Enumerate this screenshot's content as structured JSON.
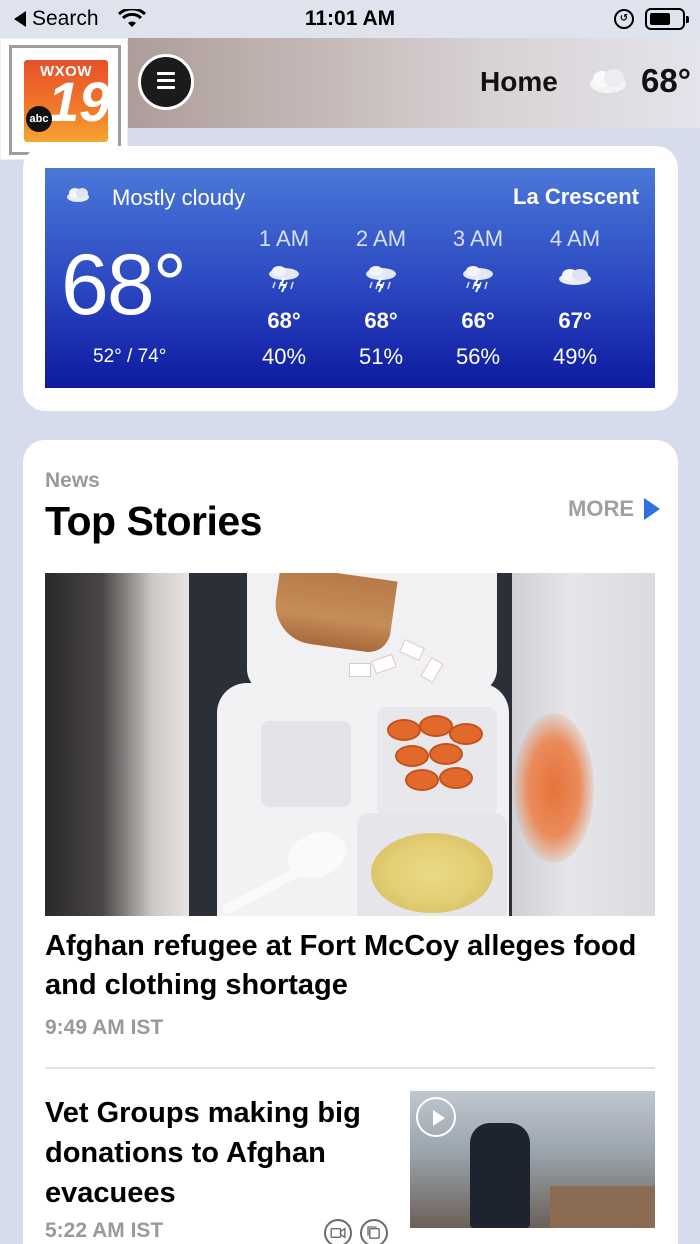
{
  "status_bar": {
    "back_label": "Search",
    "time": "11:01 AM"
  },
  "header": {
    "logo_call_sign": "WXOW",
    "logo_channel": "19",
    "logo_network": "abc",
    "home_label": "Home",
    "current_temp": "68°",
    "current_icon": "cloud-icon"
  },
  "weather": {
    "condition": "Mostly cloudy",
    "location": "La Crescent",
    "temperature": "68°",
    "range": "52° / 74°",
    "hourly": [
      {
        "time": "1 AM",
        "temp": "68°",
        "precip": "40%",
        "icon": "thunderstorm-icon"
      },
      {
        "time": "2 AM",
        "temp": "68°",
        "precip": "51%",
        "icon": "thunderstorm-icon"
      },
      {
        "time": "3 AM",
        "temp": "66°",
        "precip": "56%",
        "icon": "thunderstorm-icon"
      },
      {
        "time": "4 AM",
        "temp": "67°",
        "precip": "49%",
        "icon": "cloud-icon"
      }
    ]
  },
  "news": {
    "eyebrow": "News",
    "title": "Top Stories",
    "more_label": "MORE",
    "stories": [
      {
        "headline": "Afghan refugee at Fort McCoy alleges food and clothing shortage",
        "time": "9:49 AM IST"
      },
      {
        "headline": "Vet Groups making big donations to Afghan evacuees",
        "time": "5:22 AM IST"
      }
    ]
  },
  "colors": {
    "accent_blue": "#2f6fe0",
    "weather_panel_top": "#4a78d8",
    "weather_panel_bottom": "#0d1aa0",
    "logo_orange": "#e8502a"
  }
}
